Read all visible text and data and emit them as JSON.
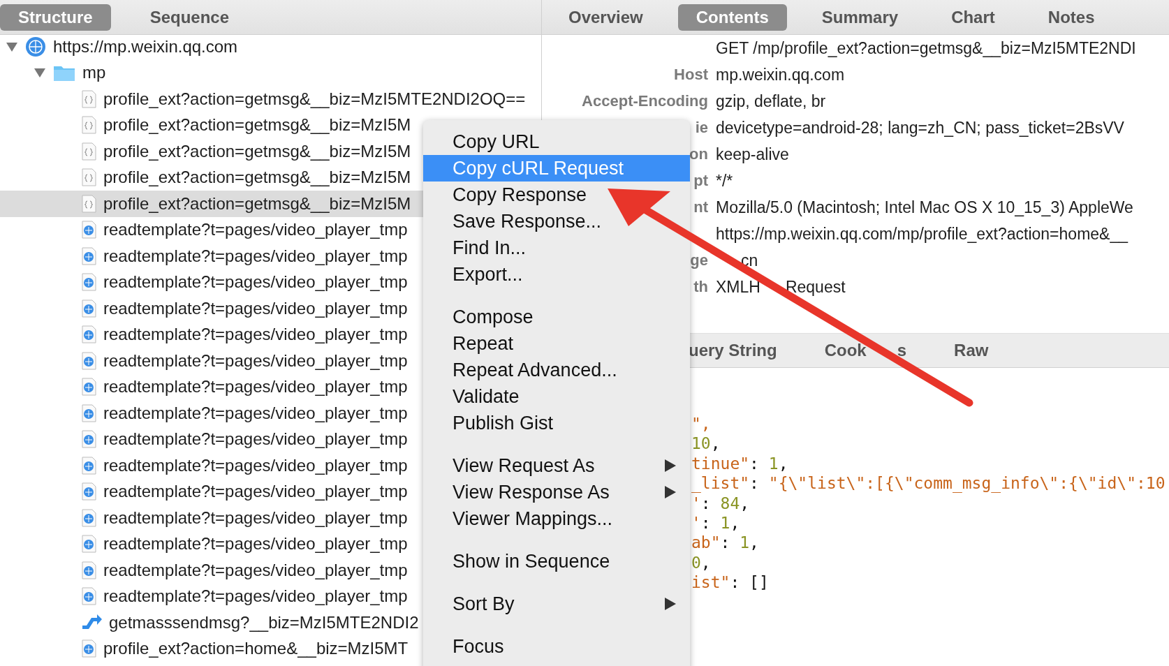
{
  "left_tabs": [
    {
      "label": "Structure",
      "selected": true
    },
    {
      "label": "Sequence",
      "selected": false
    }
  ],
  "tree": [
    {
      "label": "https://mp.weixin.qq.com",
      "kind": "host",
      "selected": false,
      "expanded": true,
      "children": [
        {
          "label": "mp",
          "kind": "folder",
          "selected": false,
          "expanded": true,
          "children": [
            {
              "label": "profile_ext?action=getmsg&__biz=MzI5MTE2NDI2OQ==",
              "kind": "json",
              "selected": false
            },
            {
              "label": "profile_ext?action=getmsg&__biz=MzI5M",
              "kind": "json",
              "selected": false
            },
            {
              "label": "profile_ext?action=getmsg&__biz=MzI5M",
              "kind": "json",
              "selected": false
            },
            {
              "label": "profile_ext?action=getmsg&__biz=MzI5M",
              "kind": "json",
              "selected": false
            },
            {
              "label": "profile_ext?action=getmsg&__biz=MzI5M",
              "kind": "json",
              "selected": true
            },
            {
              "label": "readtemplate?t=pages/video_player_tmp",
              "kind": "page",
              "selected": false
            },
            {
              "label": "readtemplate?t=pages/video_player_tmp",
              "kind": "page",
              "selected": false
            },
            {
              "label": "readtemplate?t=pages/video_player_tmp",
              "kind": "page",
              "selected": false
            },
            {
              "label": "readtemplate?t=pages/video_player_tmp",
              "kind": "page",
              "selected": false
            },
            {
              "label": "readtemplate?t=pages/video_player_tmp",
              "kind": "page",
              "selected": false
            },
            {
              "label": "readtemplate?t=pages/video_player_tmp",
              "kind": "page",
              "selected": false
            },
            {
              "label": "readtemplate?t=pages/video_player_tmp",
              "kind": "page",
              "selected": false
            },
            {
              "label": "readtemplate?t=pages/video_player_tmp",
              "kind": "page",
              "selected": false
            },
            {
              "label": "readtemplate?t=pages/video_player_tmp",
              "kind": "page",
              "selected": false
            },
            {
              "label": "readtemplate?t=pages/video_player_tmp",
              "kind": "page",
              "selected": false
            },
            {
              "label": "readtemplate?t=pages/video_player_tmp",
              "kind": "page",
              "selected": false
            },
            {
              "label": "readtemplate?t=pages/video_player_tmp",
              "kind": "page",
              "selected": false
            },
            {
              "label": "readtemplate?t=pages/video_player_tmp",
              "kind": "page",
              "selected": false
            },
            {
              "label": "readtemplate?t=pages/video_player_tmp",
              "kind": "page",
              "selected": false
            },
            {
              "label": "readtemplate?t=pages/video_player_tmp",
              "kind": "page",
              "selected": false
            },
            {
              "label": "getmasssendmsg?__biz=MzI5MTE2NDI2",
              "kind": "redirect",
              "selected": false
            },
            {
              "label": "profile_ext?action=home&__biz=MzI5MT",
              "kind": "page",
              "selected": false
            }
          ]
        }
      ]
    }
  ],
  "right_tabs": [
    {
      "label": "Overview",
      "selected": false
    },
    {
      "label": "Contents",
      "selected": true
    },
    {
      "label": "Summary",
      "selected": false
    },
    {
      "label": "Chart",
      "selected": false
    },
    {
      "label": "Notes",
      "selected": false
    }
  ],
  "headers": [
    {
      "value": "GET /mp/profile_ext?action=getmsg&__biz=MzI5MTE2NDI"
    },
    {
      "key": "Host",
      "value": "mp.weixin.qq.com"
    },
    {
      "key": "Accept-Encoding",
      "value": "gzip, deflate, br"
    },
    {
      "key": "ie",
      "value": "devicetype=android-28; lang=zh_CN; pass_ticket=2BsVV"
    },
    {
      "key": "on",
      "value": "keep-alive"
    },
    {
      "key": "pt",
      "value": "*/*"
    },
    {
      "key": "nt",
      "value": "Mozilla/5.0 (Macintosh; Intel Mac OS X 10_15_3) AppleWe"
    },
    {
      "value": "https://mp.weixin.qq.com/mp/profile_ext?action=home&__"
    },
    {
      "key": "ge",
      "parts": [
        "cn"
      ],
      "hidden_start": true
    },
    {
      "key": "th",
      "parts": [
        "XMLH",
        "Request"
      ]
    }
  ],
  "lower_tabs": [
    {
      "label": "uery String",
      "selected": false
    },
    {
      "parts": [
        "Cook",
        "s"
      ],
      "selected": false
    },
    {
      "label": "Raw",
      "selected": false
    }
  ],
  "code_lines": [
    [
      {
        "text": "\",",
        "kind": "string"
      }
    ],
    [
      {
        "text": "10",
        "kind": "number"
      },
      {
        "text": ",",
        "kind": "punct"
      }
    ],
    [
      {
        "text": "tinue\"",
        "kind": "string"
      },
      {
        "text": ": ",
        "kind": "punct"
      },
      {
        "text": "1",
        "kind": "number"
      },
      {
        "text": ",",
        "kind": "punct"
      }
    ],
    [
      {
        "text": "_list\"",
        "kind": "string"
      },
      {
        "text": ": ",
        "kind": "punct"
      },
      {
        "text": "\"{\\\"list\\\":[{\\\"comm_msg_info\\\":{\\\"id\\\":10",
        "kind": "string"
      }
    ],
    [
      {
        "text": "'",
        "kind": "string"
      },
      {
        "text": ": ",
        "kind": "punct"
      },
      {
        "text": "84",
        "kind": "number"
      },
      {
        "text": ",",
        "kind": "punct"
      }
    ],
    [
      {
        "text": "'",
        "kind": "string"
      },
      {
        "text": ": ",
        "kind": "punct"
      },
      {
        "text": "1",
        "kind": "number"
      },
      {
        "text": ",",
        "kind": "punct"
      }
    ],
    [
      {
        "text": "ab\"",
        "kind": "string"
      },
      {
        "text": ": ",
        "kind": "punct"
      },
      {
        "text": "1",
        "kind": "number"
      },
      {
        "text": ",",
        "kind": "punct"
      }
    ],
    [
      {
        "text": "0",
        "kind": "number"
      },
      {
        "text": ",",
        "kind": "punct"
      }
    ],
    [
      {
        "text": "ist\"",
        "kind": "string"
      },
      {
        "text": ": []",
        "kind": "punct"
      }
    ]
  ],
  "context_menu": [
    {
      "kind": "item",
      "label": "Copy URL",
      "selected": false,
      "submenu": false
    },
    {
      "kind": "item",
      "label": "Copy cURL Request",
      "selected": true,
      "submenu": false
    },
    {
      "kind": "item",
      "label": "Copy Response",
      "selected": false,
      "submenu": false
    },
    {
      "kind": "item",
      "label": "Save Response...",
      "selected": false,
      "submenu": false
    },
    {
      "kind": "item",
      "label": "Find In...",
      "selected": false,
      "submenu": false
    },
    {
      "kind": "item",
      "label": "Export...",
      "selected": false,
      "submenu": false
    },
    {
      "kind": "separator"
    },
    {
      "kind": "item",
      "label": "Compose",
      "selected": false,
      "submenu": false
    },
    {
      "kind": "item",
      "label": "Repeat",
      "selected": false,
      "submenu": false
    },
    {
      "kind": "item",
      "label": "Repeat Advanced...",
      "selected": false,
      "submenu": false
    },
    {
      "kind": "item",
      "label": "Validate",
      "selected": false,
      "submenu": false
    },
    {
      "kind": "item",
      "label": "Publish Gist",
      "selected": false,
      "submenu": false
    },
    {
      "kind": "separator"
    },
    {
      "kind": "item",
      "label": "View Request As",
      "selected": false,
      "submenu": true
    },
    {
      "kind": "item",
      "label": "View Response As",
      "selected": false,
      "submenu": true
    },
    {
      "kind": "item",
      "label": "Viewer Mappings...",
      "selected": false,
      "submenu": false
    },
    {
      "kind": "separator"
    },
    {
      "kind": "item",
      "label": "Show in Sequence",
      "selected": false,
      "submenu": false
    },
    {
      "kind": "separator"
    },
    {
      "kind": "item",
      "label": "Sort By",
      "selected": false,
      "submenu": true
    },
    {
      "kind": "separator"
    },
    {
      "kind": "item",
      "label": "Focus",
      "selected": false,
      "submenu": false
    }
  ]
}
